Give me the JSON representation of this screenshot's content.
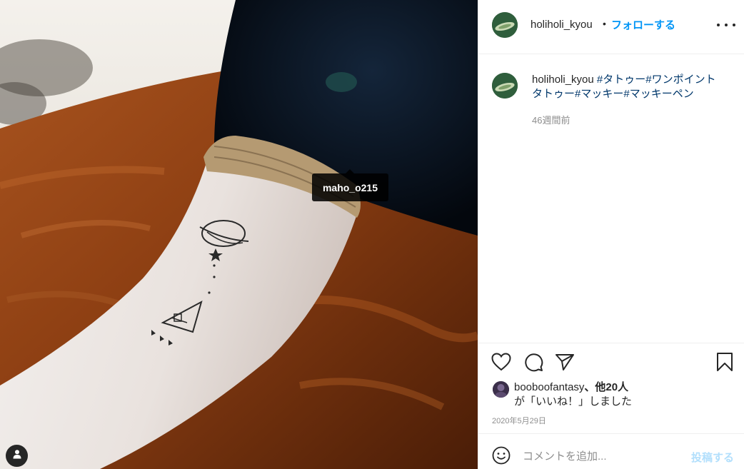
{
  "photo": {
    "tag_label": "maho_o215",
    "user_tag_icon": "person-icon"
  },
  "header": {
    "username": "holiholi_kyou",
    "separator": "•",
    "follow_label": "フォローする",
    "more_icon": "more-horizontal-icon"
  },
  "caption": {
    "username": "holiholi_kyou",
    "hashtags": [
      "#タトゥー",
      "#ワンポイントタトゥー",
      "#マッキー",
      "#マッキーペン"
    ],
    "time_ago": "46週間前"
  },
  "actions": {
    "like_icon": "heart-icon",
    "comment_icon": "comment-icon",
    "share_icon": "send-icon",
    "save_icon": "bookmark-icon"
  },
  "likes": {
    "user": "booboofantasy",
    "others": "、他20人",
    "suffix": "が「いいね！」しました"
  },
  "post_date": "2020年5月29日",
  "comment": {
    "placeholder": "コメントを追加...",
    "post_label": "投稿する",
    "emoji_icon": "smiley-icon"
  },
  "colors": {
    "accent": "#0095f6",
    "hashtag": "#00376b",
    "muted": "#8e8e8e",
    "post_disabled": "#b2dffc"
  }
}
